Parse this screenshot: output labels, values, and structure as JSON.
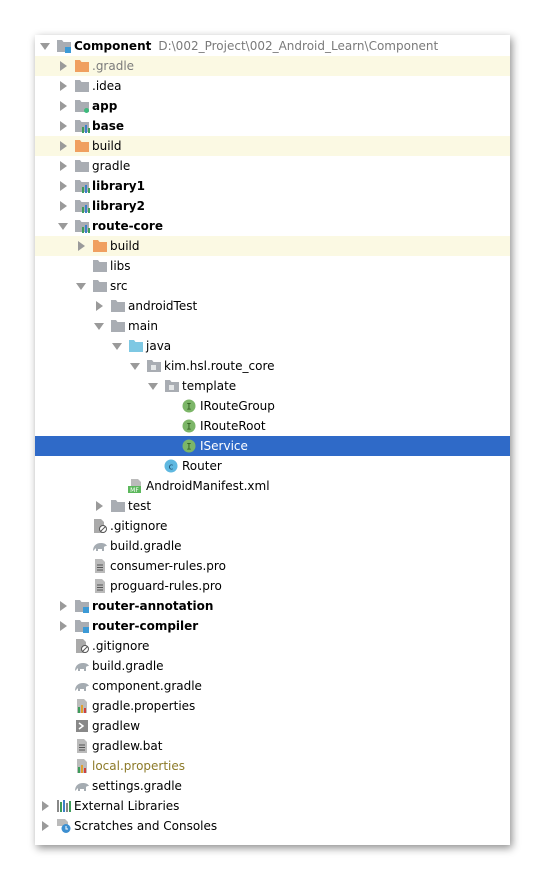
{
  "tree": [
    {
      "label": "Component",
      "path": "D:\\002_Project\\002_Android_Learn\\Component",
      "level": 0,
      "state": "expanded",
      "icon": "module-folder-icon",
      "bold": true
    },
    {
      "label": ".gradle",
      "level": 1,
      "state": "collapsed",
      "icon": "excluded-folder-icon",
      "highlight": true,
      "style": "muted"
    },
    {
      "label": ".idea",
      "level": 1,
      "state": "collapsed",
      "icon": "folder-icon"
    },
    {
      "label": "app",
      "level": 1,
      "state": "collapsed",
      "icon": "app-module-icon",
      "bold": true
    },
    {
      "label": "base",
      "level": 1,
      "state": "collapsed",
      "icon": "library-module-icon",
      "bold": true
    },
    {
      "label": "build",
      "level": 1,
      "state": "collapsed",
      "icon": "excluded-folder-icon",
      "highlight": true
    },
    {
      "label": "gradle",
      "level": 1,
      "state": "collapsed",
      "icon": "folder-icon"
    },
    {
      "label": "library1",
      "level": 1,
      "state": "collapsed",
      "icon": "library-module-icon",
      "bold": true
    },
    {
      "label": "library2",
      "level": 1,
      "state": "collapsed",
      "icon": "library-module-icon",
      "bold": true
    },
    {
      "label": "route-core",
      "level": 1,
      "state": "expanded",
      "icon": "library-module-icon",
      "bold": true
    },
    {
      "label": "build",
      "level": 2,
      "state": "collapsed",
      "icon": "excluded-folder-icon",
      "highlight": true
    },
    {
      "label": "libs",
      "level": 2,
      "state": "none",
      "icon": "folder-icon"
    },
    {
      "label": "src",
      "level": 2,
      "state": "expanded",
      "icon": "folder-icon"
    },
    {
      "label": "androidTest",
      "level": 3,
      "state": "collapsed",
      "icon": "folder-icon"
    },
    {
      "label": "main",
      "level": 3,
      "state": "expanded",
      "icon": "folder-icon"
    },
    {
      "label": "java",
      "level": 4,
      "state": "expanded",
      "icon": "source-folder-icon"
    },
    {
      "label": "kim.hsl.route_core",
      "level": 5,
      "state": "expanded",
      "icon": "package-icon"
    },
    {
      "label": "template",
      "level": 6,
      "state": "expanded",
      "icon": "package-icon"
    },
    {
      "label": "IRouteGroup",
      "level": 7,
      "state": "none",
      "icon": "interface-icon"
    },
    {
      "label": "IRouteRoot",
      "level": 7,
      "state": "none",
      "icon": "interface-icon"
    },
    {
      "label": "IService",
      "level": 7,
      "state": "none",
      "icon": "interface-icon",
      "selected": true
    },
    {
      "label": "Router",
      "level": 6,
      "state": "none",
      "icon": "class-icon"
    },
    {
      "label": "AndroidManifest.xml",
      "level": 4,
      "state": "none",
      "icon": "manifest-icon"
    },
    {
      "label": "test",
      "level": 3,
      "state": "collapsed",
      "icon": "folder-icon"
    },
    {
      "label": ".gitignore",
      "level": 2,
      "state": "none",
      "icon": "ignore-file-icon"
    },
    {
      "label": "build.gradle",
      "level": 2,
      "state": "none",
      "icon": "gradle-icon"
    },
    {
      "label": "consumer-rules.pro",
      "level": 2,
      "state": "none",
      "icon": "text-file-icon"
    },
    {
      "label": "proguard-rules.pro",
      "level": 2,
      "state": "none",
      "icon": "text-file-icon"
    },
    {
      "label": "router-annotation",
      "level": 1,
      "state": "collapsed",
      "icon": "module-folder-icon",
      "bold": true
    },
    {
      "label": "router-compiler",
      "level": 1,
      "state": "collapsed",
      "icon": "module-folder-icon",
      "bold": true
    },
    {
      "label": ".gitignore",
      "level": 1,
      "state": "none",
      "icon": "ignore-file-icon"
    },
    {
      "label": "build.gradle",
      "level": 1,
      "state": "none",
      "icon": "gradle-icon"
    },
    {
      "label": "component.gradle",
      "level": 1,
      "state": "none",
      "icon": "gradle-icon"
    },
    {
      "label": "gradle.properties",
      "level": 1,
      "state": "none",
      "icon": "properties-icon"
    },
    {
      "label": "gradlew",
      "level": 1,
      "state": "none",
      "icon": "shell-script-icon"
    },
    {
      "label": "gradlew.bat",
      "level": 1,
      "state": "none",
      "icon": "text-file-icon"
    },
    {
      "label": "local.properties",
      "level": 1,
      "state": "none",
      "icon": "properties-icon",
      "style": "olive"
    },
    {
      "label": "settings.gradle",
      "level": 1,
      "state": "none",
      "icon": "gradle-icon"
    },
    {
      "label": "External Libraries",
      "level": 0,
      "state": "collapsed",
      "icon": "libraries-icon"
    },
    {
      "label": "Scratches and Consoles",
      "level": 0,
      "state": "collapsed",
      "icon": "scratches-icon"
    }
  ],
  "colors": {
    "selection": "#2f6ac8",
    "highlight": "#fbf9e3",
    "folder": "#a9adb3",
    "excluded_folder": "#f0a060",
    "source_folder": "#7ec8e3",
    "interface": "#7cb668",
    "class": "#5fb8e0"
  }
}
